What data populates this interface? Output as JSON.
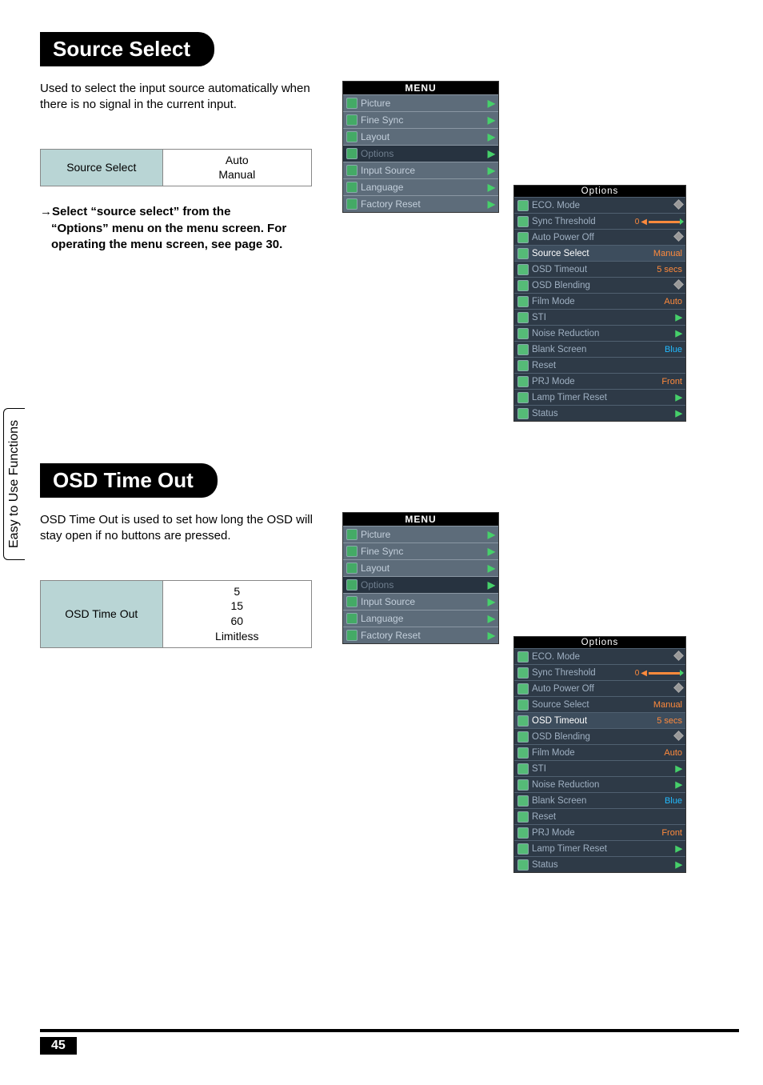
{
  "sideTab": "Easy to Use Functions",
  "pageNumber": "45",
  "section1": {
    "title": "Source Select",
    "desc": "Used to select the input source automatically when there is no signal in the current input.",
    "paramLabel": "Source Select",
    "paramValues": "Auto\nManual",
    "instructionLead": "→",
    "instructionHead": "Select “source select” from the",
    "instructionBody": "“Options” menu on the menu screen. For operating the menu screen, see page 30."
  },
  "section2": {
    "title": "OSD Time Out",
    "desc": "OSD Time Out is used to set how long the OSD will stay open if no buttons are pressed.",
    "paramLabel": "OSD Time Out",
    "paramValues": "5\n15\n60\nLimitless"
  },
  "menu": {
    "title": "MENU",
    "items": [
      "Picture",
      "Fine Sync",
      "Layout",
      "Options",
      "Input Source",
      "Language",
      "Factory Reset"
    ]
  },
  "options": {
    "title": "Options",
    "rows": [
      {
        "label": "ECO. Mode",
        "value": "diamond"
      },
      {
        "label": "Sync Threshold",
        "value": "slider"
      },
      {
        "label": "Auto Power Off",
        "value": "diamond"
      },
      {
        "label": "Source Select",
        "value": "Manual"
      },
      {
        "label": "OSD Timeout",
        "value": "5 secs"
      },
      {
        "label": "OSD Blending",
        "value": "diamond"
      },
      {
        "label": "Film Mode",
        "value": "Auto"
      },
      {
        "label": "STI",
        "value": "arrow"
      },
      {
        "label": "Noise Reduction",
        "value": "arrow"
      },
      {
        "label": "Blank Screen",
        "value": "Blue"
      },
      {
        "label": "Reset",
        "value": ""
      },
      {
        "label": "PRJ Mode",
        "value": "Front"
      },
      {
        "label": "Lamp Timer Reset",
        "value": "arrow"
      },
      {
        "label": "Status",
        "value": "arrow"
      }
    ],
    "highlightA": 3,
    "highlightB": 4
  },
  "sliderZero": "0"
}
